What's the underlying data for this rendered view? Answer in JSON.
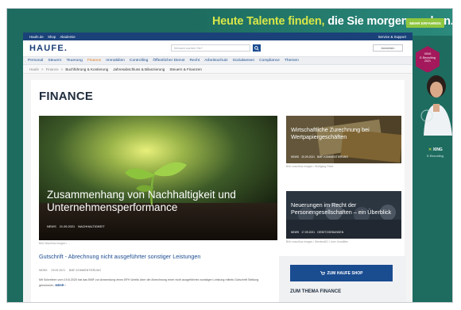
{
  "banner": {
    "text_part1": "Heute Talente finden,",
    "text_part2": "die Sie morgen suchen.",
    "button": "MEHR ERFAHREN"
  },
  "ad": {
    "badge_line1": "XING",
    "badge_line2": "E-Recruiting",
    "badge_line3": "2021",
    "brand": "XING",
    "brand_mark": "✕",
    "sub": "E-Recruiting"
  },
  "topbar": {
    "links": [
      "Haufe.de",
      "Shop",
      "Akademie"
    ],
    "right": "Service & Support"
  },
  "header": {
    "logo": "HAUFE.",
    "search_placeholder": "Wonach suchen Sie?",
    "login": "Anmelden"
  },
  "nav": {
    "items": [
      "Personal",
      "Steuern",
      "Teuerung",
      "Finance",
      "Immobilien",
      "Controlling",
      "Öffentlicher Dienst",
      "Recht",
      "Arbeitsschutz",
      "Sozialwesen",
      "Compliance",
      "Themen"
    ],
    "active_index": 3
  },
  "subnav": {
    "crumbs": [
      "Haufe",
      ">",
      "Finance",
      ">"
    ],
    "items": [
      "Buchführung & Kontierung",
      "Jahresabschluss & Bilanzierung",
      "Steuern & Finanzen"
    ]
  },
  "page": {
    "title": "FINANCE"
  },
  "hero": {
    "title": "Zusammenhang von Nachhaltigkeit und Unternehmensperformance",
    "meta_type": "NEWS",
    "meta_date": "21.09.2021",
    "meta_tag": "NACHHALTIGKEIT",
    "caption": "Bild: Mauritius Images / ..."
  },
  "side_cards": [
    {
      "title": "Wirtschaftliche Zurechnung bei Wertpapiergeschäften",
      "meta_type": "NEWS",
      "meta_date": "20.09.2021",
      "meta_tag": "BMF-KOMMENTIERUNG",
      "caption": "Bild: mauritius images / Wolfgang Filser"
    },
    {
      "title": "Neuerungen im Recht der Personengesellschaften – ein Überblick",
      "meta_type": "NEWS",
      "meta_date": "17.09.2021",
      "meta_tag": "GESETZGEBUNGEN",
      "caption": "Bild: mauritius images / Westend61 / Uwe Umstätter"
    }
  ],
  "article": {
    "title": "Gutschrift - Abrechnung nicht ausgeführter sonstiger Leistungen",
    "meta_type": "NEWS",
    "meta_date": "09.09.2021",
    "meta_tag": "BMF-KOMMENTIERUNG",
    "teaser": "Mit Schreiben vom 19.8.2020 hat das BMF zur Anwendung eines BFH Urteils über die Abrechnung einer nicht ausgeführten sonstigen Leistung mittels Gutschrift Stellung genommen.",
    "more": "MEHR"
  },
  "sidebar": {
    "shop_button": "ZUM HAUFE SHOP",
    "thema": "ZUM THEMA FINANCE"
  },
  "colors": {
    "skin": "#1e6c60",
    "brand_blue": "#1a4c90",
    "accent_orange": "#e07b1f",
    "lime": "#d7e648"
  }
}
